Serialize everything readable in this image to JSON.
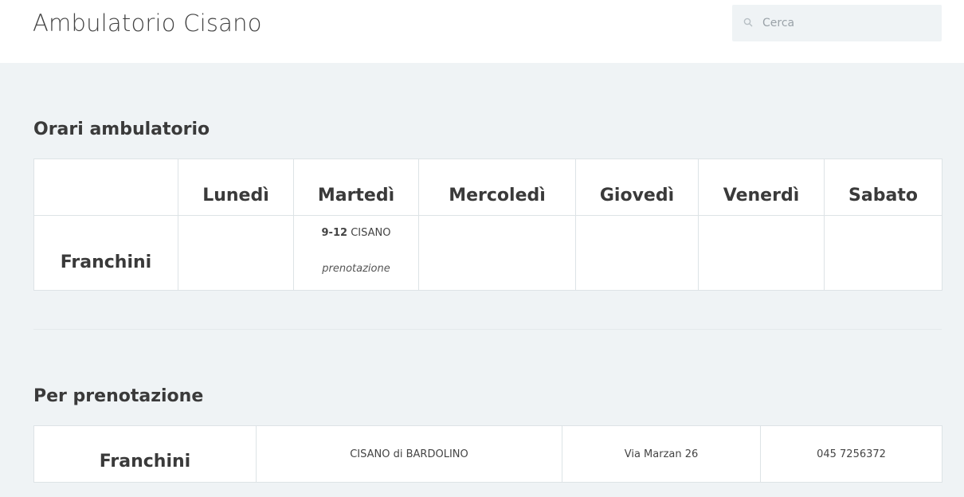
{
  "header": {
    "site_title": "Ambulatorio Cisano",
    "search_placeholder": "Cerca"
  },
  "schedule": {
    "title": "Orari ambulatorio",
    "days": [
      "Lunedì",
      "Martedì",
      "Mercoledì",
      "Giovedì",
      "Venerdì",
      "Sabato"
    ],
    "rows": [
      {
        "doctor": "Franchini",
        "tuesday": {
          "time": "9-12",
          "place": "CISANO",
          "note": "prenotazione"
        }
      }
    ]
  },
  "booking": {
    "title": "Per prenotazione",
    "rows": [
      {
        "doctor": "Franchini",
        "location": "CISANO di BARDOLINO",
        "address": "Via Marzan 26",
        "phone": "045 7256372"
      }
    ]
  }
}
